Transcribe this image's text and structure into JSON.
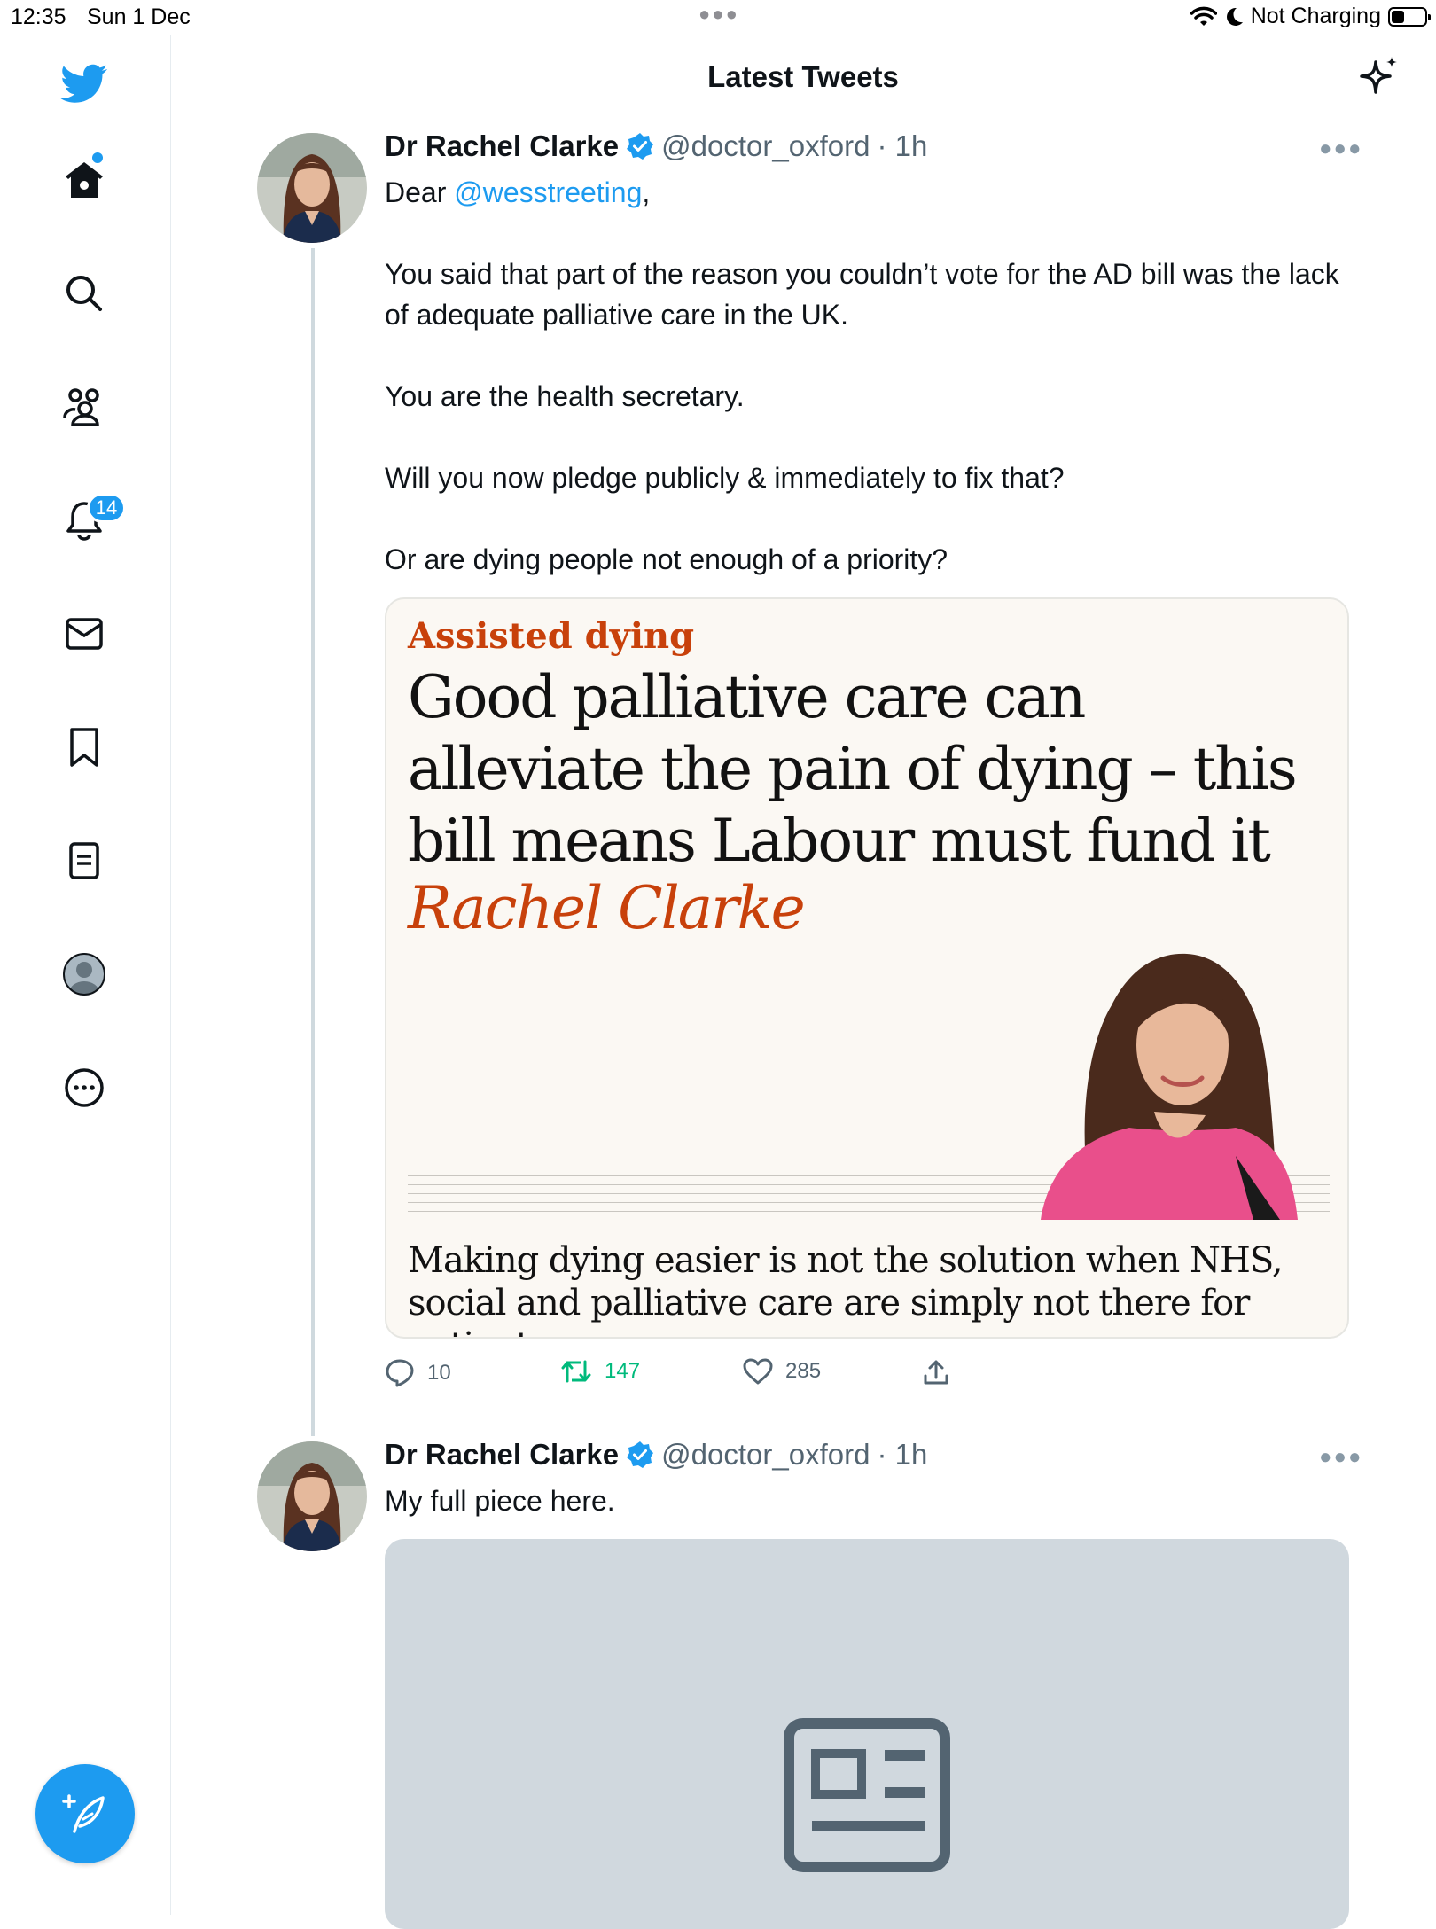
{
  "status_bar": {
    "time": "12:35",
    "date": "Sun 1 Dec",
    "charging": "Not Charging",
    "battery_level": 0.4
  },
  "sidebar": {
    "items": [
      {
        "icon": "home-icon",
        "has_dot": true
      },
      {
        "icon": "search-icon"
      },
      {
        "icon": "communities-icon"
      },
      {
        "icon": "bell-icon",
        "badge": "14"
      },
      {
        "icon": "mail-icon"
      },
      {
        "icon": "bookmark-icon"
      },
      {
        "icon": "lists-icon"
      },
      {
        "icon": "profile-icon"
      },
      {
        "icon": "more-circle-icon"
      }
    ],
    "compose_icon": "compose-feather-icon"
  },
  "header": {
    "title": "Latest Tweets",
    "sparkle_icon": "sparkle-icon"
  },
  "tweets": [
    {
      "name": "Dr Rachel Clarke",
      "handle": "@doctor_oxford",
      "time": "· 1h",
      "greeting_prefix": "Dear ",
      "mention": "@wesstreeting",
      "greeting_suffix": ",",
      "paragraphs": [
        "You said that part of the reason you couldn’t vote for the AD bill was the lack of adequate palliative care in the UK.",
        "You are the health secretary.",
        "Will you now pledge publicly & immediately to fix that?",
        "Or are dying people not enough of a priority?"
      ],
      "card": {
        "kicker": "Assisted dying",
        "headline": "Good palliative care can alleviate the pain of dying – this bill means Labour must fund it",
        "byline": "Rachel Clarke",
        "standfirst": "Making dying easier is not the solution when NHS, social and palliative care are simply not there for patients"
      },
      "stats": {
        "replies": "10",
        "retweets": "147",
        "likes": "285"
      }
    },
    {
      "name": "Dr Rachel Clarke",
      "handle": "@doctor_oxford",
      "time": "· 1h",
      "text": "My full piece here."
    }
  ],
  "colors": {
    "accent": "#1d9bf0",
    "retweet": "#00ba7c",
    "guardian_orange": "#c8410b"
  }
}
